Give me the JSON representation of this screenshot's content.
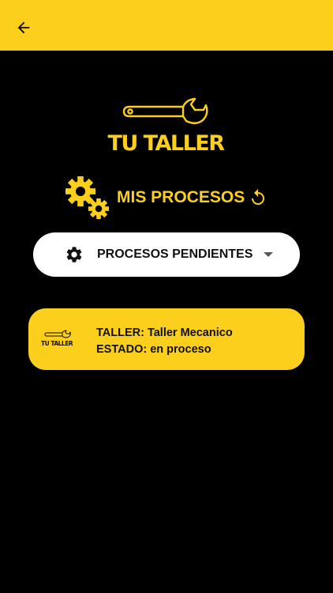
{
  "colors": {
    "accent": "#FCCF1C",
    "background": "#000000",
    "dropdown_bg": "#FFFFFF",
    "text_dark": "#111111"
  },
  "app_bar": {
    "back_icon": "arrow-left-icon"
  },
  "logo": {
    "text": "TU TALLER",
    "icon": "wrench-icon"
  },
  "header": {
    "title": "MIS PROCESOS",
    "icon": "gears-icon",
    "refresh_icon": "refresh-icon"
  },
  "filter": {
    "selected": "PROCESOS PENDIENTES",
    "icon": "gear-icon",
    "arrow_icon": "caret-down-icon"
  },
  "processes": [
    {
      "logo_text": "TU TALLER",
      "taller_line": "TALLER: Taller Mecanico",
      "estado_line": "ESTADO: en proceso"
    }
  ]
}
